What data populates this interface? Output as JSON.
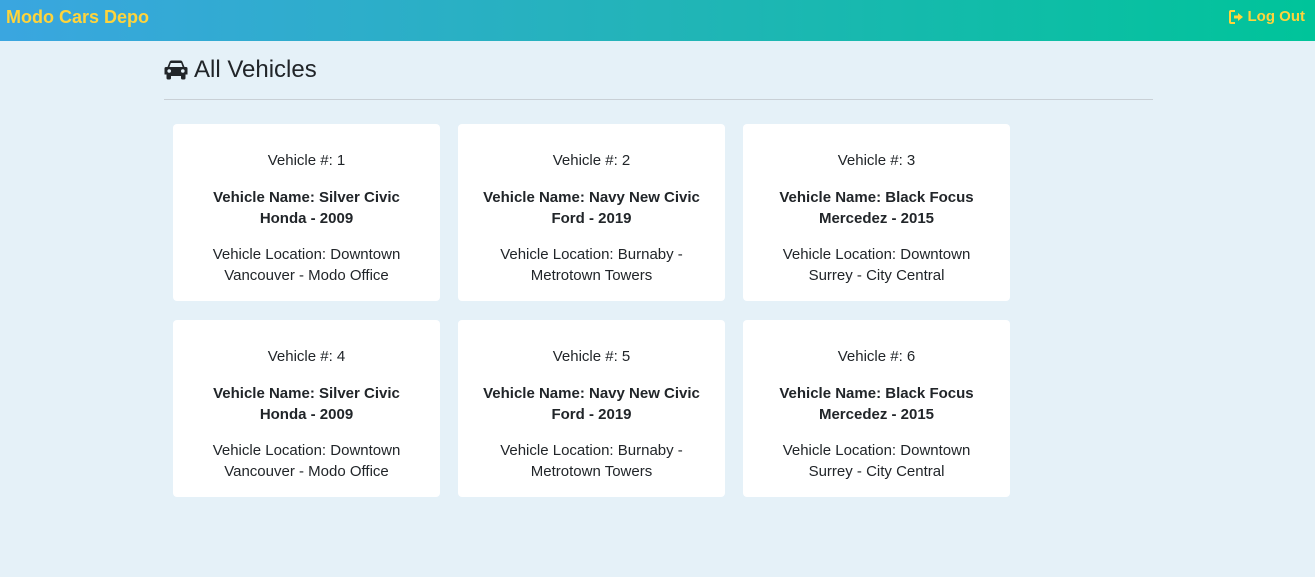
{
  "navbar": {
    "brand": "Modo Cars Depo",
    "logout_label": "Log Out",
    "logout_icon": "sign-out-icon"
  },
  "header": {
    "title": "All Vehicles",
    "icon": "car-icon"
  },
  "vehicles": [
    {
      "number": "Vehicle #: 1",
      "name": "Vehicle Name: Silver Civic Honda - 2009",
      "location": "Vehicle Location: Downtown Vancouver - Modo Office"
    },
    {
      "number": "Vehicle #: 2",
      "name": "Vehicle Name: Navy New Civic Ford - 2019",
      "location": "Vehicle Location: Burnaby - Metrotown Towers"
    },
    {
      "number": "Vehicle #: 3",
      "name": "Vehicle Name: Black Focus Mercedez - 2015",
      "location": "Vehicle Location: Downtown Surrey - City Central"
    },
    {
      "number": "Vehicle #: 4",
      "name": "Vehicle Name: Silver Civic Honda - 2009",
      "location": "Vehicle Location: Downtown Vancouver - Modo Office"
    },
    {
      "number": "Vehicle #: 5",
      "name": "Vehicle Name: Navy New Civic Ford - 2019",
      "location": "Vehicle Location: Burnaby - Metrotown Towers"
    },
    {
      "number": "Vehicle #: 6",
      "name": "Vehicle Name: Black Focus Mercedez - 2015",
      "location": "Vehicle Location: Downtown Surrey - City Central"
    }
  ],
  "colors": {
    "brand_text": "#ffd43b",
    "background": "#e5f1f8",
    "card": "#ffffff",
    "navbar_gradient_start": "#3aa6e0",
    "navbar_gradient_end": "#00c49a"
  }
}
